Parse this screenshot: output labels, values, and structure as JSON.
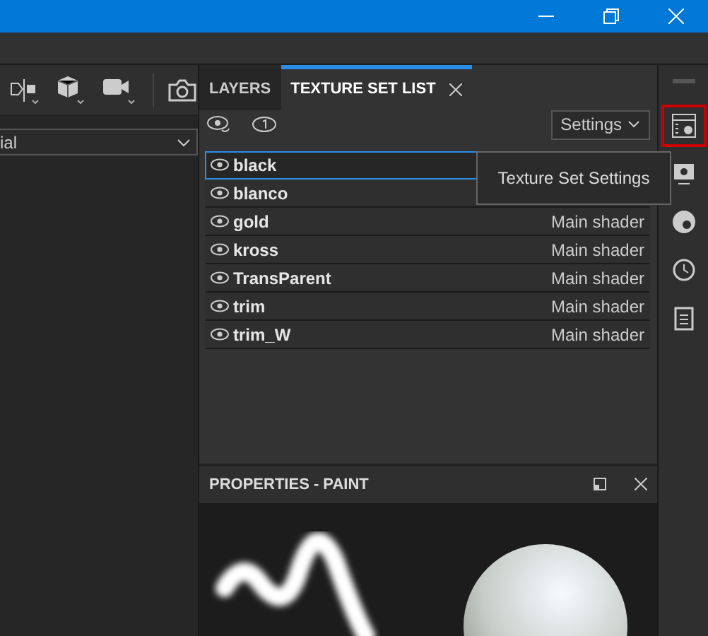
{
  "left_panel": {
    "dropdown": {
      "value": "ial"
    }
  },
  "panel": {
    "tabs": [
      {
        "label": "LAYERS",
        "selected": false
      },
      {
        "label": "TEXTURE SET LIST",
        "selected": true
      }
    ],
    "settings_button": "Settings",
    "texture_sets": [
      {
        "name": "black",
        "selected": true
      },
      {
        "name": "blanco",
        "selected": false
      },
      {
        "name": "gold",
        "shader": "Main shader",
        "selected": false
      },
      {
        "name": "kross",
        "shader": "Main shader",
        "selected": false
      },
      {
        "name": "TransParent",
        "shader": "Main shader",
        "selected": false
      },
      {
        "name": "trim",
        "shader": "Main shader",
        "selected": false
      },
      {
        "name": "trim_W",
        "shader": "Main shader",
        "selected": false
      }
    ],
    "tooltip": "Texture Set Settings"
  },
  "properties": {
    "title": "PROPERTIES - PAINT"
  },
  "right_toolbar": [
    {
      "selected": true
    },
    {
      "selected": false
    },
    {
      "selected": false
    },
    {
      "selected": false
    },
    {
      "selected": false
    }
  ]
}
